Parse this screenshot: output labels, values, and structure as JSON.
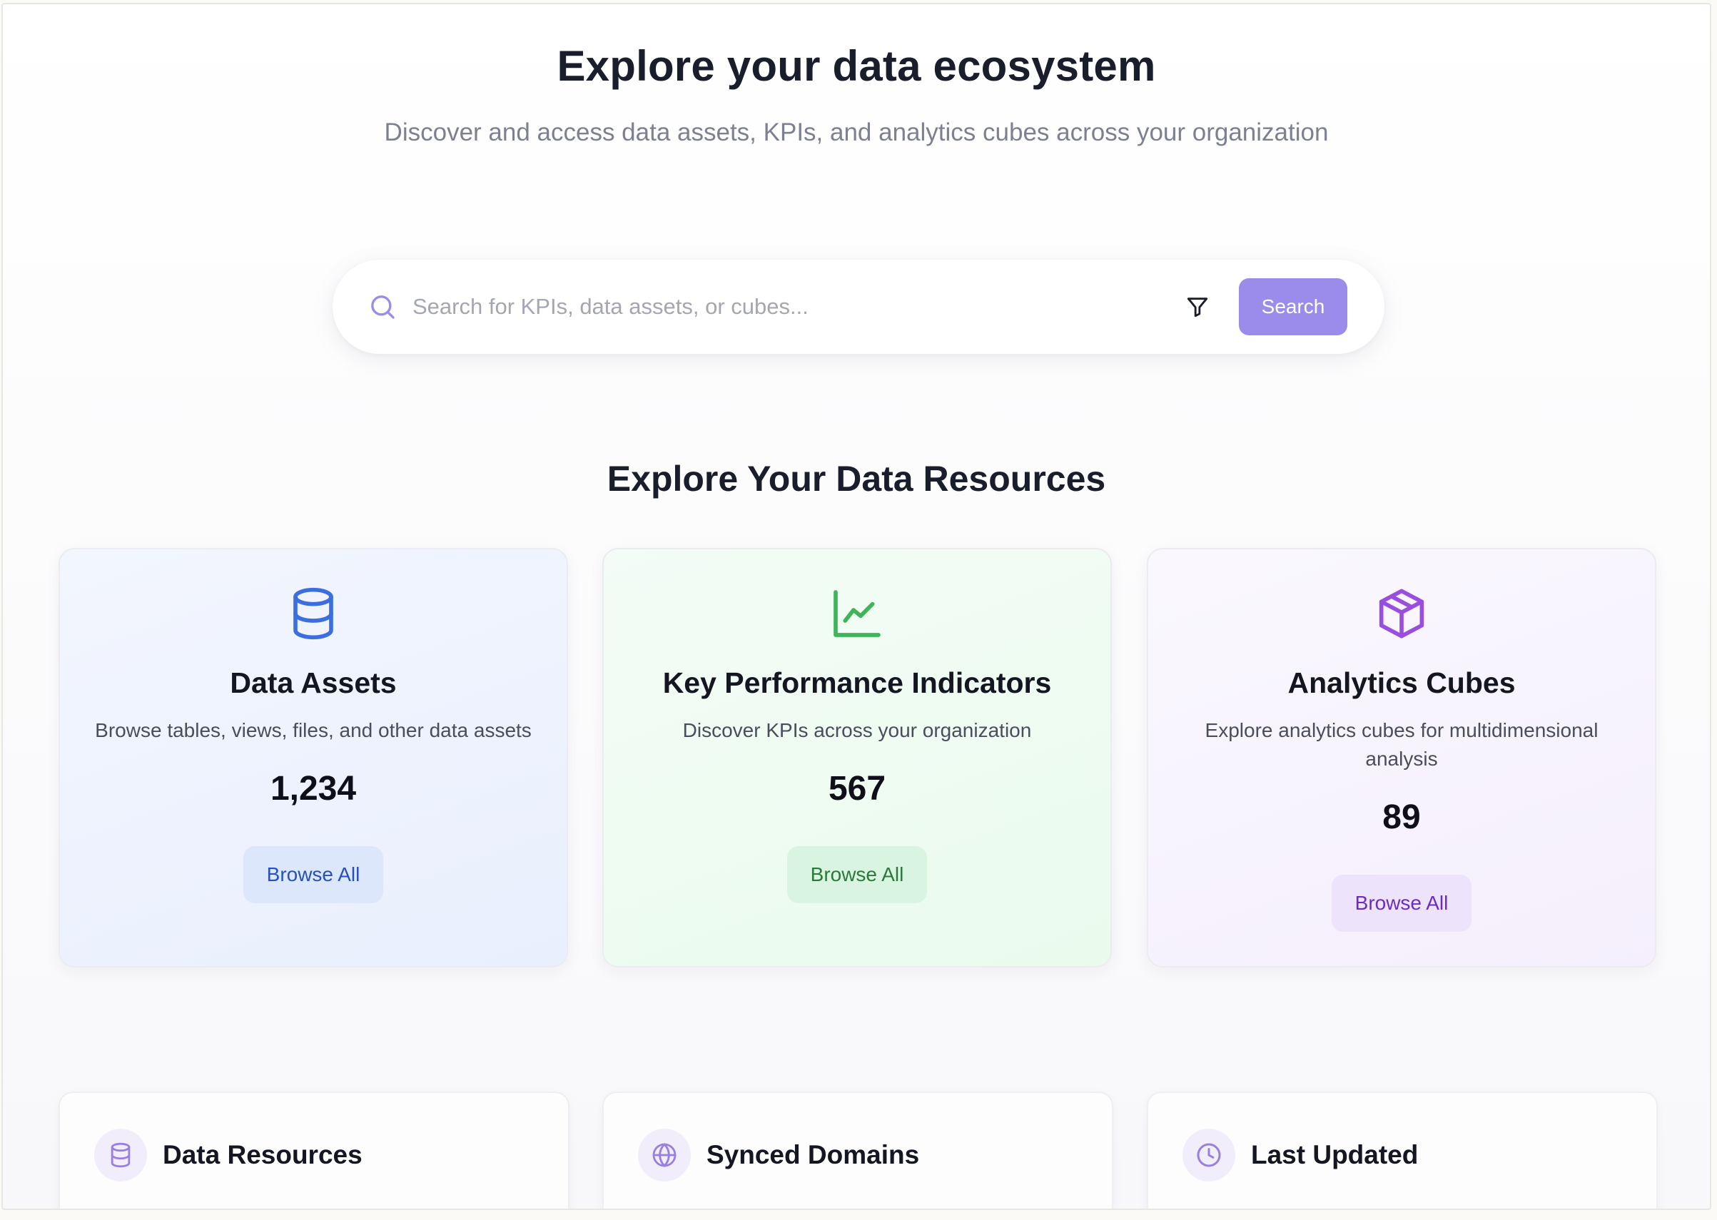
{
  "hero": {
    "title": "Explore your data ecosystem",
    "subtitle": "Discover and access data assets, KPIs, and analytics cubes across your organization"
  },
  "search": {
    "placeholder": "Search for KPIs, data assets, or cubes...",
    "value": "",
    "button_label": "Search",
    "icon": "search-icon",
    "filter_icon": "filter-icon"
  },
  "resources": {
    "section_title": "Explore Your Data Resources",
    "cards": [
      {
        "title": "Data Assets",
        "description": "Browse tables, views, files, and other data assets",
        "count": "1,234",
        "button_label": "Browse All",
        "icon": "database-icon",
        "accent": "#3b6fe0"
      },
      {
        "title": "Key Performance Indicators",
        "description": "Discover KPIs across your organization",
        "count": "567",
        "button_label": "Browse All",
        "icon": "line-chart-icon",
        "accent": "#3fb45a"
      },
      {
        "title": "Analytics Cubes",
        "description": "Explore analytics cubes for multidimensional analysis",
        "count": "89",
        "button_label": "Browse All",
        "icon": "cube-icon",
        "accent": "#9a4ee0"
      }
    ]
  },
  "stats": [
    {
      "title": "Data Resources",
      "icon": "database-icon"
    },
    {
      "title": "Synced Domains",
      "icon": "globe-icon"
    },
    {
      "title": "Last Updated",
      "icon": "clock-icon"
    }
  ],
  "colors": {
    "primary": "#9b8bea",
    "text_dark": "#1a1d2b",
    "text_muted": "#7d8090"
  }
}
